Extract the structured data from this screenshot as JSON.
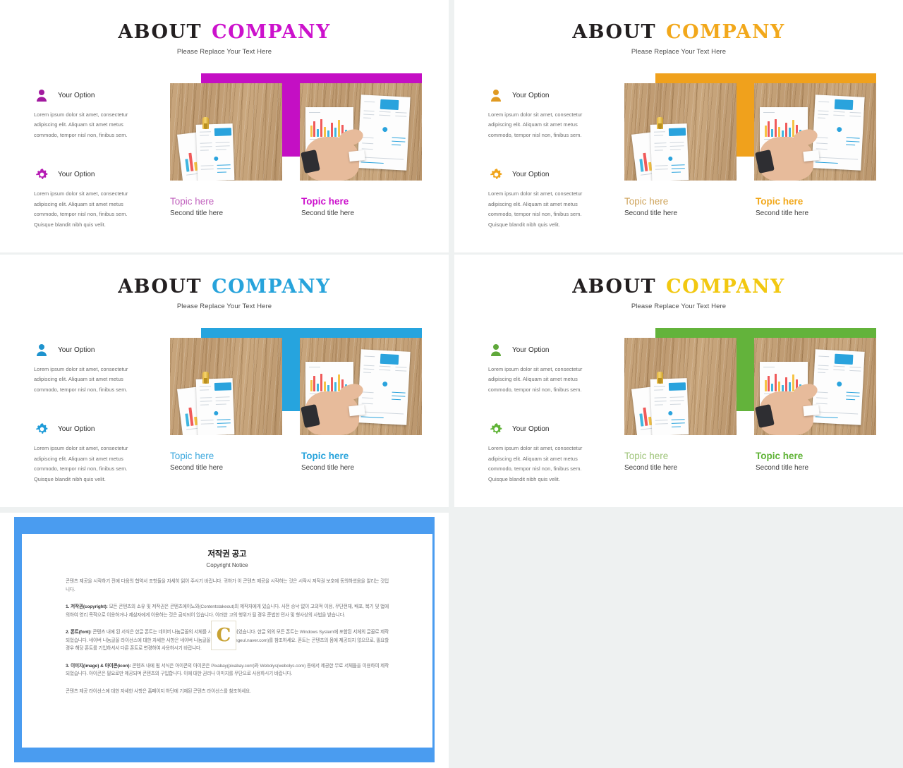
{
  "deck": {
    "heading": {
      "word1": "ABOUT",
      "word2": "COMPANY",
      "subtitle": "Please Replace Your Text Here"
    },
    "option_label": "Your Option",
    "option_body_1": "Lorem ipsum dolor sit amet, consectetur adipiscing elit. Aliquam sit amet metus commodo,  tempor nisl non, finibus sem.",
    "option_body_2": "Lorem ipsum dolor sit amet, consectetur adipiscing elit. Aliquam sit amet metus commodo,  tempor nisl non, finibus sem. Quisque blandit nibh quis velit.",
    "caption_title": "Topic here",
    "caption_sub": "Second title here",
    "icons": {
      "person": "person-icon",
      "gear": "gear-icon"
    }
  },
  "slides": [
    {
      "id": "slide-purple",
      "accent": "#CC11CC",
      "accent_soft": "#C061BD",
      "band": "#C40FC4"
    },
    {
      "id": "slide-orange",
      "accent": "#F2A81B",
      "accent_soft": "#CFA45C",
      "band": "#F0A11C"
    },
    {
      "id": "slide-blue",
      "accent": "#27A3DB",
      "accent_soft": "#3FA9DE",
      "band": "#26A4DE"
    },
    {
      "id": "slide-green",
      "accent": "#5FB336",
      "accent_soft": "#9FC47A",
      "band": "#63B33B"
    }
  ],
  "copyright": {
    "title": "저작권 공고",
    "title_en": "Copyright Notice",
    "logo_letter": "C",
    "intro": "콘텐츠 제공을 시작하기 전에 다음의 협약서 조항들을 자세히 읽어 주시기 바랍니다. 귀하가 이 콘텐츠 제공을 시작하는 것은 시작시 저작권 보호에 동의하셨음을 알리는 것입니다.",
    "items": [
      {
        "label": "1. 저작권(copyright):",
        "text": " 모든 콘텐츠의 소유 및 저작권은 콘텐츠에이노와(Contentstakeout)의 제작자에게 있습니다. 사전 승낙 없이 고의적 이용, 무단전재, 배포, 복기 및 법에 의하여 영리 목적으로 이용하거나 제삼자에게 이용하는 것은 금지되어 있습니다. 이러한 고의 행위가 될 경우 준법한 민사 및 형사상의 사법을 받습니다."
      },
      {
        "label": "2. 폰트(font):",
        "text": " 콘텐츠 내에 된 서식은 한글 폰트는 네이버 나눔글꼴의 서체를 사용하여 제작되었습니다. 한글 외의 모든 폰트는 Windows System에 포함된 서체의 글꼴로 제작되었습니다. 네이버 나눔글꼴 라이선스에 대한 자세한 사항은 네이버 나눔글꼴 홈페이지(hangeul.naver.com)를 참조하세요. 폰트는 콘텐츠의 몸에 제공되지 않으므로, 필요할 경우 해당 폰트를 기입하셔서 다른 폰트로 변경하여 사용하시기 바랍니다."
      },
      {
        "label": "3. 이미지(image) & 아이콘(icon):",
        "text": " 콘텐츠 내에 됨 서식은 아이콘의 아이콘은 Pixabay(pixabay.com)와 Webolys(webolys.com) 등에서 제공한 무료 서체들을 이용하여 제작되었습니다. 아이콘은 필요로만 제공되며 콘텐츠의 구입합니다. 이에 대한 권리나 이미지를 무단으로 사용하시기 바랍니다."
      }
    ],
    "footer": "콘텐츠 제공 라이선스에 대한 자세한 사항은 홈페이지 하단에 기재된 콘텐츠 라이선스를 참조하세요."
  }
}
